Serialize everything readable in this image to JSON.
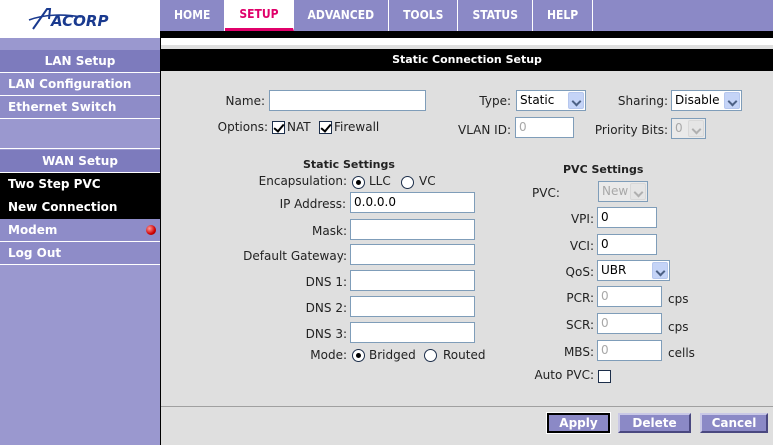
{
  "logo": {
    "text": "ACORP"
  },
  "nav": {
    "tabs": [
      "HOME",
      "SETUP",
      "ADVANCED",
      "TOOLS",
      "STATUS",
      "HELP"
    ],
    "active": "SETUP"
  },
  "sidebar": {
    "lan_header": "LAN Setup",
    "lan_configuration": "LAN Configuration",
    "ethernet_switch": "Ethernet Switch",
    "wan_header": "WAN Setup",
    "two_step_pvc": "Two Step PVC",
    "new_connection": "New Connection",
    "modem": "Modem",
    "log_out": "Log Out"
  },
  "panel": {
    "title": "Static Connection Setup",
    "name_label": "Name:",
    "name_value": "",
    "type_label": "Type:",
    "type_value": "Static",
    "sharing_label": "Sharing:",
    "sharing_value": "Disable",
    "options_label": "Options:",
    "nat_label": "NAT",
    "firewall_label": "Firewall",
    "vlan_label": "VLAN ID:",
    "vlan_value": "0",
    "priority_label": "Priority Bits:",
    "priority_value": "0",
    "static_settings": {
      "heading": "Static Settings",
      "encapsulation_label": "Encapsulation:",
      "llc_label": "LLC",
      "vc_label": "VC",
      "ip_label": "IP Address:",
      "ip_value": "0.0.0.0",
      "mask_label": "Mask:",
      "mask_value": "",
      "gateway_label": "Default Gateway:",
      "gateway_value": "",
      "dns1_label": "DNS 1:",
      "dns1_value": "",
      "dns2_label": "DNS 2:",
      "dns2_value": "",
      "dns3_label": "DNS 3:",
      "dns3_value": "",
      "mode_label": "Mode:",
      "bridged_label": "Bridged",
      "routed_label": "Routed"
    },
    "pvc_settings": {
      "heading": "PVC Settings",
      "pvc_label": "PVC:",
      "pvc_value": "New",
      "vpi_label": "VPI:",
      "vpi_value": "0",
      "vci_label": "VCI:",
      "vci_value": "0",
      "qos_label": "QoS:",
      "qos_value": "UBR",
      "pcr_label": "PCR:",
      "pcr_value": "0",
      "pcr_unit": "cps",
      "scr_label": "SCR:",
      "scr_value": "0",
      "scr_unit": "cps",
      "mbs_label": "MBS:",
      "mbs_value": "0",
      "mbs_unit": "cells",
      "auto_pvc_label": "Auto PVC:"
    },
    "buttons": {
      "apply": "Apply",
      "delete": "Delete",
      "cancel": "Cancel"
    }
  },
  "colors": {
    "nav_bg": "#8b89c6",
    "sidebar_bg": "#9a98cf",
    "active_tab": "#e0006a",
    "modem_status": "#d00000"
  }
}
